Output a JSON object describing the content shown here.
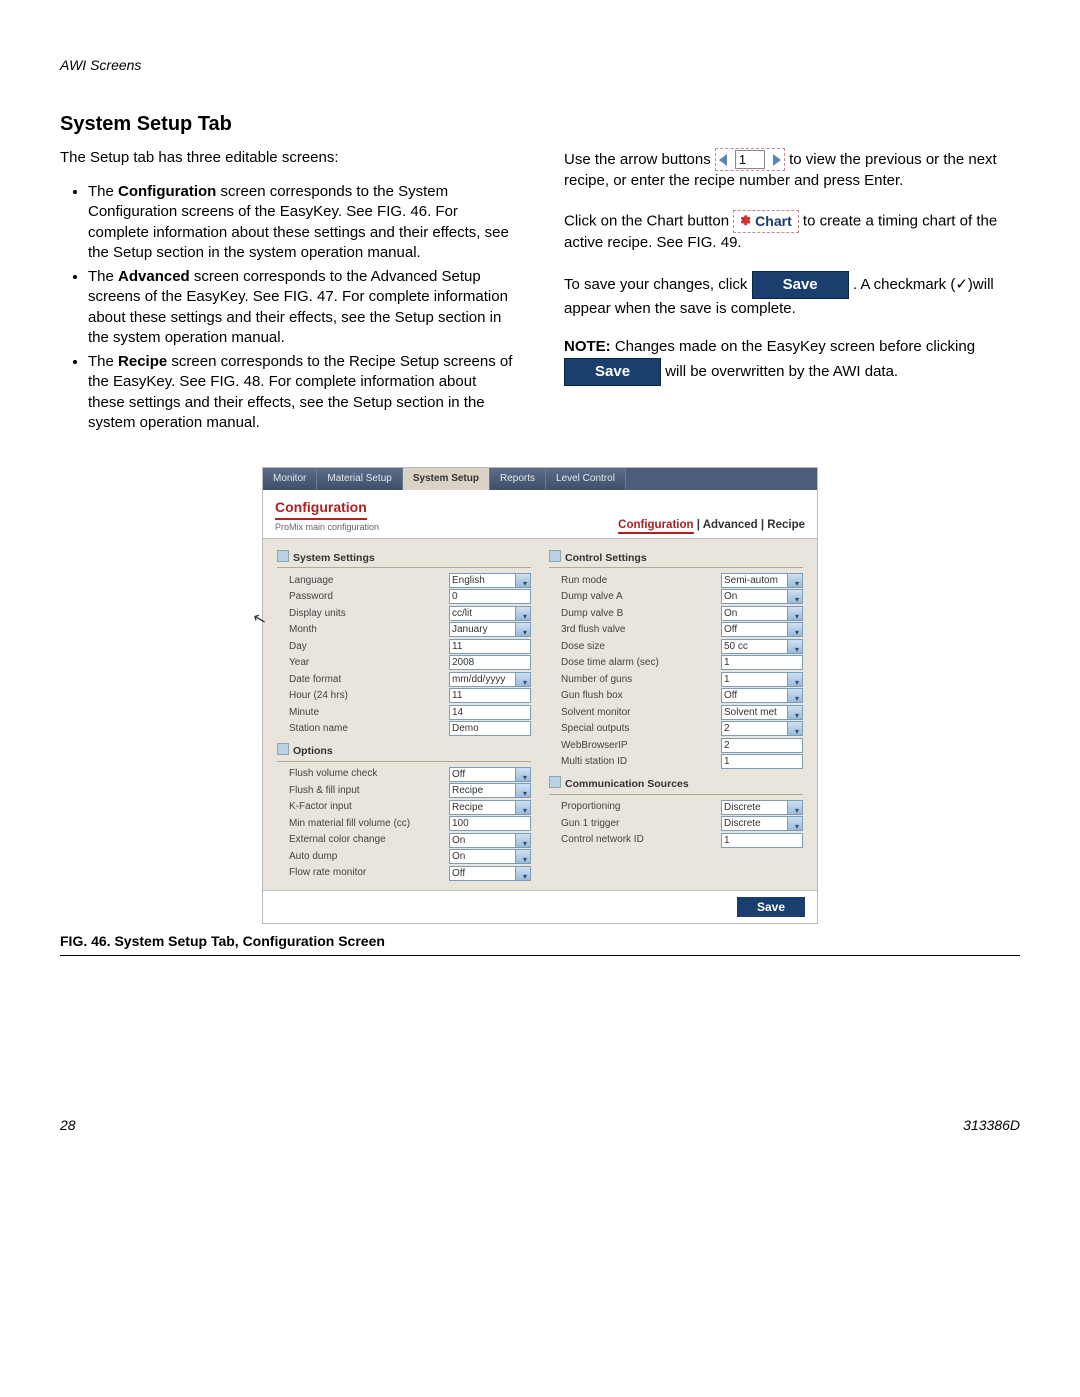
{
  "header": "AWI Screens",
  "title": "System Setup Tab",
  "intro": "The Setup tab has three editable screens:",
  "bullets": [
    {
      "prefix": "The ",
      "bold": "Configuration",
      "rest": " screen corresponds to the System Configuration screens of the EasyKey. See FIG. 46. For complete information about these settings and their effects, see the Setup section in the system operation manual."
    },
    {
      "prefix": "The ",
      "bold": "Advanced",
      "rest": " screen corresponds to the Advanced Setup screens of the EasyKey. See FIG. 47. For complete information about these settings and their effects, see the Setup section in the system operation manual."
    },
    {
      "prefix": "The ",
      "bold": "Recipe",
      "rest": " screen corresponds to the Recipe Setup screens of the EasyKey. See FIG. 48. For complete information about these settings and their effects, see the Setup section in the system operation manual."
    }
  ],
  "right": {
    "arrow_text_pre": "Use the arrow buttons ",
    "arrow_text_post": " to view the previous or the next recipe, or enter the recipe number and press Enter.",
    "recipe_number": "1",
    "chart_pre": "Click on the Chart button ",
    "chart_label": "Chart",
    "chart_post": " to create a timing chart of the active recipe. See FIG. 49.",
    "save_pre": "To save your changes, click ",
    "save_label": "Save",
    "save_post": ". A checkmark (✓)will appear when the save is complete.",
    "note_bold": "NOTE:",
    "note_text_1": " Changes made on the EasyKey screen before clicking ",
    "note_text_2": " will be overwritten by the AWI data."
  },
  "screenshot": {
    "tabs": [
      "Monitor",
      "Material Setup",
      "System Setup",
      "Reports",
      "Level Control"
    ],
    "active_tab": "System Setup",
    "panel_title": "Configuration",
    "panel_sub": "ProMix main configuration",
    "subnav": [
      "Configuration",
      "Advanced",
      "Recipe"
    ],
    "subnav_active": "Configuration",
    "sections": {
      "system_settings": {
        "title": "System Settings",
        "rows": [
          {
            "label": "Language",
            "value": "English",
            "type": "select"
          },
          {
            "label": "Password",
            "value": "0",
            "type": "input"
          },
          {
            "label": "Display units",
            "value": "cc/lit",
            "type": "select"
          },
          {
            "label": "Month",
            "value": "January",
            "type": "select"
          },
          {
            "label": "Day",
            "value": "11",
            "type": "input"
          },
          {
            "label": "Year",
            "value": "2008",
            "type": "input"
          },
          {
            "label": "Date format",
            "value": "mm/dd/yyyy",
            "type": "select"
          },
          {
            "label": "Hour (24 hrs)",
            "value": "11",
            "type": "input"
          },
          {
            "label": "Minute",
            "value": "14",
            "type": "input"
          },
          {
            "label": "Station name",
            "value": "Demo",
            "type": "input"
          }
        ]
      },
      "options": {
        "title": "Options",
        "rows": [
          {
            "label": "Flush volume check",
            "value": "Off",
            "type": "select"
          },
          {
            "label": "Flush & fill input",
            "value": "Recipe",
            "type": "select"
          },
          {
            "label": "K-Factor input",
            "value": "Recipe",
            "type": "select"
          },
          {
            "label": "Min material fill volume (cc)",
            "value": "100",
            "type": "input"
          },
          {
            "label": "External color change",
            "value": "On",
            "type": "select"
          },
          {
            "label": "Auto dump",
            "value": "On",
            "type": "select"
          },
          {
            "label": "Flow rate monitor",
            "value": "Off",
            "type": "select"
          }
        ]
      },
      "control_settings": {
        "title": "Control Settings",
        "rows": [
          {
            "label": "Run mode",
            "value": "Semi-autom",
            "type": "select"
          },
          {
            "label": "Dump valve A",
            "value": "On",
            "type": "select"
          },
          {
            "label": "Dump valve B",
            "value": "On",
            "type": "select"
          },
          {
            "label": "3rd flush valve",
            "value": "Off",
            "type": "select"
          },
          {
            "label": "Dose size",
            "value": "50 cc",
            "type": "select"
          },
          {
            "label": "Dose time alarm (sec)",
            "value": "1",
            "type": "input"
          },
          {
            "label": "Number of guns",
            "value": "1",
            "type": "select"
          },
          {
            "label": "Gun flush box",
            "value": "Off",
            "type": "select"
          },
          {
            "label": "Solvent monitor",
            "value": "Solvent met",
            "type": "select"
          },
          {
            "label": "Special outputs",
            "value": "2",
            "type": "select"
          },
          {
            "label": "WebBrowserIP",
            "value": "2",
            "type": "input"
          },
          {
            "label": "Multi station ID",
            "value": "1",
            "type": "input"
          }
        ]
      },
      "comm_sources": {
        "title": "Communication Sources",
        "rows": [
          {
            "label": "Proportioning",
            "value": "Discrete",
            "type": "select"
          },
          {
            "label": "Gun 1 trigger",
            "value": "Discrete",
            "type": "select"
          },
          {
            "label": "Control network ID",
            "value": "1",
            "type": "input"
          }
        ]
      }
    },
    "save": "Save"
  },
  "caption_prefix": "FIG. 46. ",
  "caption": "System Setup Tab, Configuration Screen",
  "page_number": "28",
  "doc_id": "313386D"
}
